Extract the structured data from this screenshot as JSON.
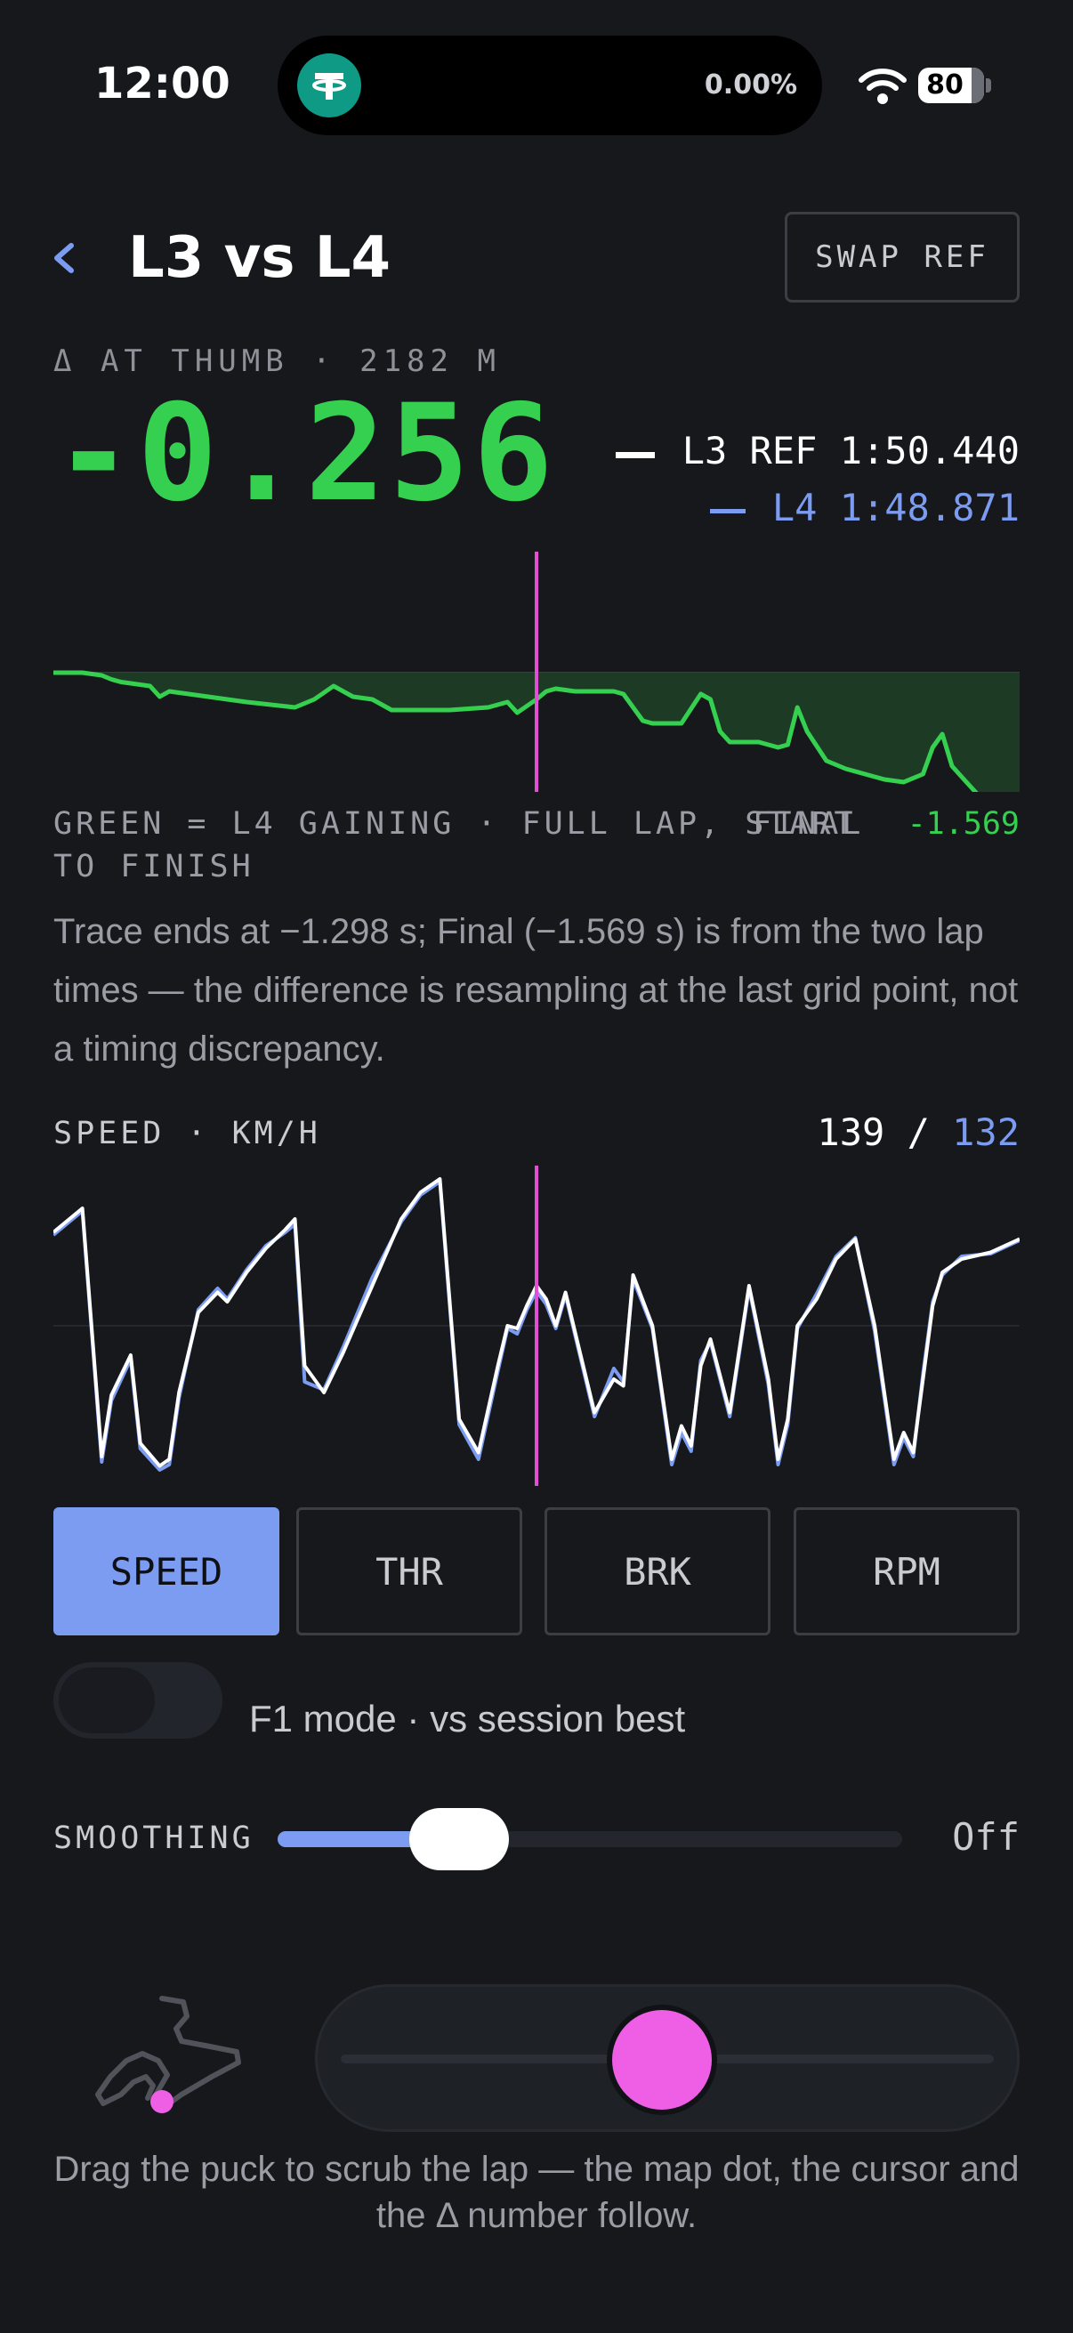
{
  "status_bar": {
    "time": "12:00",
    "island_percent": "0.00%",
    "battery": "80",
    "island_icon": "tether-icon",
    "wifi_icon": "wifi-icon"
  },
  "header": {
    "title": "L3 vs L4",
    "swap_button": "SWAP REF"
  },
  "delta": {
    "label": "Δ AT THUMB · 2182 M",
    "value": "-0.256",
    "ref_legend": "L3 REF 1:50.440",
    "cmp_legend": "L4 1:48.871",
    "note": "GREEN = L4 GAINING · FULL LAP, START TO FINISH",
    "final_label": "FINAL",
    "final_value": "-1.569",
    "explanation": "Trace ends at −1.298 s; Final (−1.569 s) is from the two lap times — the difference is resampling at the last grid point, not a timing discrepancy."
  },
  "speed": {
    "label": "SPEED · KM/H",
    "ref_value": "139",
    "separator": " / ",
    "cmp_value": "132"
  },
  "channels": [
    "SPEED",
    "THR",
    "BRK",
    "RPM"
  ],
  "active_channel": "SPEED",
  "f1_mode": {
    "label": "F1 mode · vs session best",
    "on": false
  },
  "smoothing": {
    "label": "SMOOTHING",
    "value": "Off",
    "level": 0.29
  },
  "scrub": {
    "position": 0.49,
    "hint": "Drag the puck to scrub the lap — the map dot, the cursor and the Δ number follow."
  },
  "colors": {
    "gain": "#35d04f",
    "compare": "#7c9cf2",
    "cursor": "#e04fd6",
    "reference": "#ffffff"
  },
  "chart_data": [
    {
      "type": "area",
      "series": [
        {
          "x": [
            0,
            0.03,
            0.05,
            0.06,
            0.07,
            0.1,
            0.11,
            0.12,
            0.13,
            0.16,
            0.2,
            0.25,
            0.27,
            0.29,
            0.31,
            0.33,
            0.35,
            0.38,
            0.41,
            0.45,
            0.47,
            0.48,
            0.5,
            0.51,
            0.52,
            0.54,
            0.55,
            0.58,
            0.59,
            0.61,
            0.62,
            0.65,
            0.67,
            0.68,
            0.69,
            0.7,
            0.71,
            0.73,
            0.75,
            0.76,
            0.77,
            0.78,
            0.8,
            0.82,
            0.84,
            0.86,
            0.88,
            0.9,
            0.91,
            0.92,
            0.93,
            0.94,
            0.95,
            0.96,
            0.97
          ],
          "values": [
            0,
            0,
            -0.02,
            -0.05,
            -0.07,
            -0.1,
            -0.18,
            -0.14,
            -0.15,
            -0.18,
            -0.22,
            -0.26,
            -0.2,
            -0.1,
            -0.18,
            -0.2,
            -0.28,
            -0.28,
            -0.28,
            -0.26,
            -0.22,
            -0.3,
            -0.2,
            -0.14,
            -0.12,
            -0.14,
            -0.14,
            -0.14,
            -0.16,
            -0.36,
            -0.38,
            -0.38,
            -0.16,
            -0.2,
            -0.44,
            -0.52,
            -0.52,
            -0.52,
            -0.56,
            -0.54,
            -0.26,
            -0.44,
            -0.66,
            -0.72,
            -0.76,
            -0.8,
            -0.82,
            -0.76,
            -0.56,
            -0.46,
            -0.7,
            -0.78,
            -0.86,
            -0.94,
            -0.96
          ]
        }
      ],
      "cursor_x": 0.5
    },
    {
      "type": "line",
      "title": "SPEED · KM/H",
      "series": [
        {
          "name": "L3 REF",
          "x": [
            0,
            0.03,
            0.05,
            0.06,
            0.08,
            0.09,
            0.11,
            0.12,
            0.13,
            0.15,
            0.17,
            0.18,
            0.2,
            0.22,
            0.24,
            0.25,
            0.26,
            0.28,
            0.3,
            0.33,
            0.36,
            0.38,
            0.4,
            0.42,
            0.44,
            0.46,
            0.47,
            0.48,
            0.49,
            0.5,
            0.51,
            0.52,
            0.53,
            0.56,
            0.58,
            0.59,
            0.6,
            0.62,
            0.64,
            0.65,
            0.66,
            0.67,
            0.68,
            0.7,
            0.72,
            0.74,
            0.75,
            0.76,
            0.77,
            0.79,
            0.81,
            0.83,
            0.85,
            0.87,
            0.88,
            0.89,
            0.9,
            0.91,
            0.92,
            0.94,
            0.97,
            1.0
          ],
          "values": [
            230,
            248,
            62,
            108,
            138,
            72,
            55,
            60,
            110,
            170,
            185,
            178,
            200,
            218,
            232,
            240,
            130,
            110,
            140,
            190,
            240,
            260,
            270,
            90,
            65,
            130,
            160,
            158,
            175,
            190,
            180,
            160,
            185,
            95,
            120,
            115,
            198,
            160,
            60,
            85,
            70,
            130,
            150,
            95,
            190,
            120,
            60,
            90,
            160,
            180,
            210,
            225,
            160,
            60,
            80,
            65,
            120,
            175,
            200,
            210,
            215,
            225
          ]
        },
        {
          "name": "L4",
          "x": [
            0,
            0.03,
            0.05,
            0.06,
            0.08,
            0.09,
            0.11,
            0.12,
            0.13,
            0.15,
            0.17,
            0.18,
            0.2,
            0.22,
            0.24,
            0.25,
            0.26,
            0.28,
            0.3,
            0.33,
            0.36,
            0.38,
            0.4,
            0.42,
            0.44,
            0.46,
            0.47,
            0.48,
            0.49,
            0.5,
            0.51,
            0.52,
            0.53,
            0.56,
            0.58,
            0.59,
            0.6,
            0.62,
            0.64,
            0.65,
            0.66,
            0.67,
            0.68,
            0.7,
            0.72,
            0.74,
            0.75,
            0.76,
            0.77,
            0.79,
            0.81,
            0.83,
            0.85,
            0.87,
            0.88,
            0.89,
            0.9,
            0.91,
            0.92,
            0.94,
            0.97,
            1.0
          ],
          "values": [
            228,
            246,
            58,
            104,
            135,
            68,
            52,
            56,
            106,
            172,
            188,
            180,
            202,
            220,
            230,
            236,
            118,
            112,
            144,
            196,
            238,
            258,
            268,
            86,
            60,
            126,
            158,
            154,
            172,
            186,
            176,
            158,
            183,
            92,
            128,
            118,
            195,
            158,
            56,
            80,
            66,
            134,
            148,
            92,
            188,
            116,
            56,
            86,
            158,
            184,
            212,
            226,
            156,
            56,
            76,
            62,
            124,
            178,
            198,
            212,
            214,
            224
          ]
        }
      ],
      "cursor_x": 0.5
    }
  ]
}
